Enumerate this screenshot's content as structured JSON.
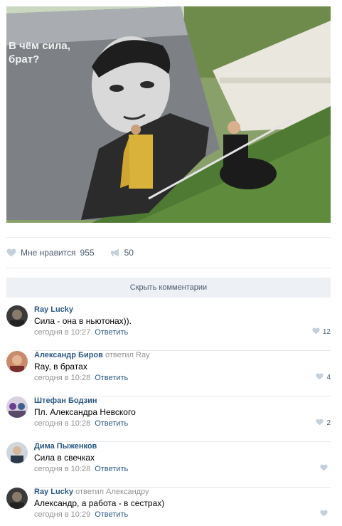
{
  "photo": {
    "mural_caption": "В чём сила,\nбрат?",
    "mural_caption_line1": "В чём сила,",
    "mural_caption_line2": "брат?"
  },
  "actions": {
    "like_label": "Мне нравится",
    "like_count": "955",
    "share_count": "50"
  },
  "comments_toggle": "Скрыть комментарии",
  "comments": [
    {
      "author": "Ray Lucky",
      "replied": "",
      "text": "Сила - она в ньютонах)).",
      "time": "сегодня в 10:27",
      "reply_label": "Ответить",
      "likes": "12"
    },
    {
      "author": "Александр Биров",
      "replied": "ответил Ray",
      "text": "Ray, в братах",
      "time": "сегодня в 10:28",
      "reply_label": "Ответить",
      "likes": "4"
    },
    {
      "author": "Штефан Бодзин",
      "replied": "",
      "text": "Пл. Александра Невского",
      "time": "сегодня в 10:28",
      "reply_label": "Ответить",
      "likes": "2"
    },
    {
      "author": "Дима Пыженков",
      "replied": "",
      "text": "Сила в свечках",
      "time": "сегодня в 10:28",
      "reply_label": "Ответить",
      "likes": ""
    },
    {
      "author": "Ray Lucky",
      "replied": "ответил Александру",
      "text": "Александр, а работа - в сестрах)",
      "time": "сегодня в 10:29",
      "reply_label": "Ответить",
      "likes": ""
    }
  ],
  "colors": {
    "link": "#2a5885",
    "muted": "#939393",
    "action": "#4c5b6e",
    "toggle_bg": "#edf0f4"
  }
}
